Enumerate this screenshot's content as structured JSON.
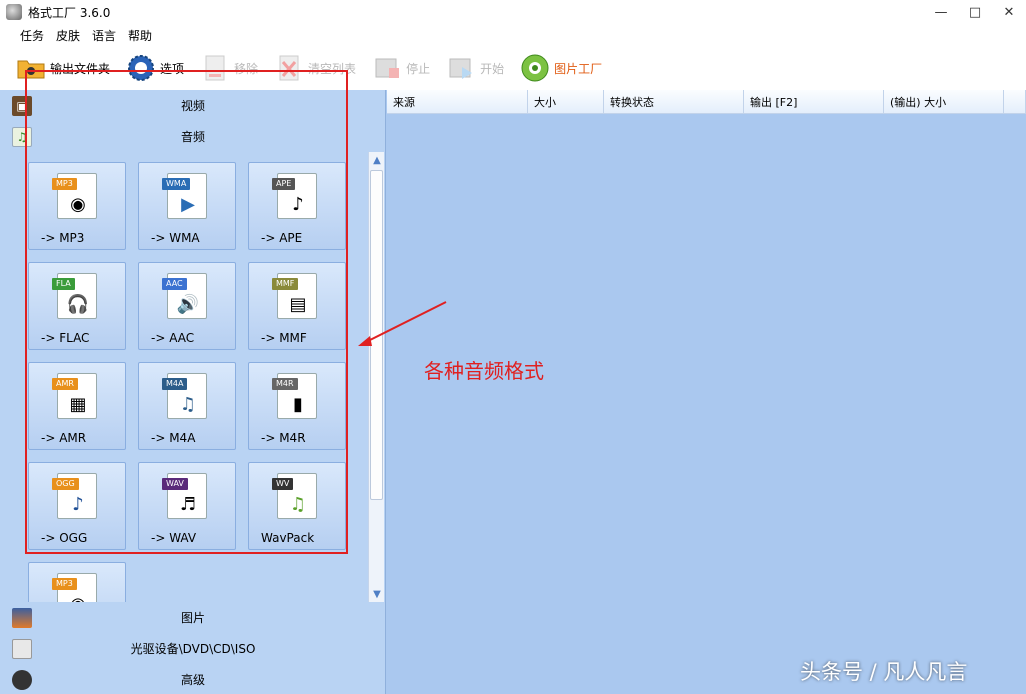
{
  "window": {
    "title": "格式工厂 3.6.0",
    "controls": [
      "—",
      "□",
      "✕"
    ]
  },
  "menu": [
    "任务",
    "皮肤",
    "语言",
    "帮助"
  ],
  "toolbar": {
    "output_folder": "输出文件夹",
    "options": "选项",
    "remove": "移除",
    "clear_list": "清空列表",
    "stop": "停止",
    "start": "开始",
    "picture_factory": "图片工厂"
  },
  "categories": {
    "video": "视频",
    "audio": "音频",
    "picture": "图片",
    "disc": "光驱设备\\DVD\\CD\\ISO",
    "advanced": "高级"
  },
  "audio_formats": [
    {
      "tag": "MP3",
      "label": "-> MP3",
      "tag_color": "#e8901c",
      "glyph": "◉"
    },
    {
      "tag": "WMA",
      "label": "-> WMA",
      "tag_color": "#2a6db5",
      "glyph": "▶"
    },
    {
      "tag": "APE",
      "label": "-> APE",
      "tag_color": "#555555",
      "glyph": "♪"
    },
    {
      "tag": "FLA",
      "label": "-> FLAC",
      "tag_color": "#3a9c3a",
      "glyph": "🎧"
    },
    {
      "tag": "AAC",
      "label": "-> AAC",
      "tag_color": "#3b72d1",
      "glyph": "🔊"
    },
    {
      "tag": "MMF",
      "label": "-> MMF",
      "tag_color": "#8a8a3a",
      "glyph": "▤"
    },
    {
      "tag": "AMR",
      "label": "-> AMR",
      "tag_color": "#e8901c",
      "glyph": "▦"
    },
    {
      "tag": "M4A",
      "label": "-> M4A",
      "tag_color": "#2c5d8a",
      "glyph": "♫"
    },
    {
      "tag": "M4R",
      "label": "-> M4R",
      "tag_color": "#666666",
      "glyph": "▮"
    },
    {
      "tag": "OGG",
      "label": "-> OGG",
      "tag_color": "#e8901c",
      "glyph": "♪"
    },
    {
      "tag": "WAV",
      "label": "-> WAV",
      "tag_color": "#5a2a7a",
      "glyph": "♬"
    },
    {
      "tag": "WV",
      "label": "WavPack",
      "tag_color": "#333333",
      "glyph": "♫"
    },
    {
      "tag": "MP3",
      "label": "",
      "tag_color": "#e8901c",
      "glyph": "◉"
    }
  ],
  "task_columns": [
    "来源",
    "大小",
    "转换状态",
    "输出 [F2]",
    "(输出) 大小"
  ],
  "annotation": {
    "text": "各种音频格式",
    "color": "#e02020"
  },
  "watermark": "头条号 / 凡人凡言"
}
